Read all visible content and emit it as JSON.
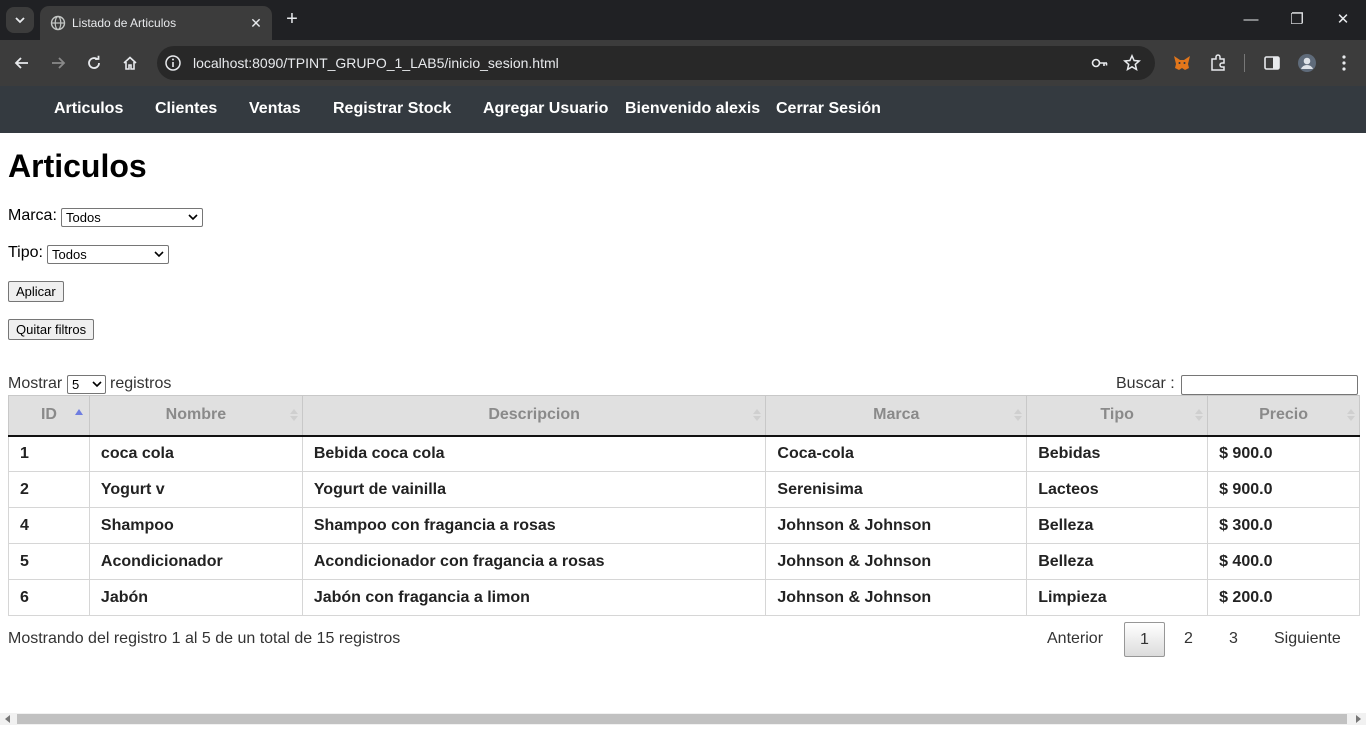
{
  "browser": {
    "tab_title": "Listado de Articulos",
    "tab_close": "✕",
    "new_tab": "+",
    "url": "localhost:8090/TPINT_GRUPO_1_LAB5/inicio_sesion.html",
    "window_controls": {
      "minimize": "—",
      "maximize": "❐",
      "close": "✕"
    }
  },
  "nav": {
    "items": [
      "Articulos",
      "Clientes",
      "Ventas",
      "Registrar Stock",
      "Agregar Usuario",
      "Bienvenido alexis",
      "Cerrar Sesión"
    ]
  },
  "page": {
    "title": "Articulos",
    "marca_label": "Marca:",
    "marca_value": "Todos",
    "tipo_label": "Tipo:",
    "tipo_value": "Todos",
    "apply_button": "Aplicar",
    "clear_button": "Quitar filtros"
  },
  "table_controls": {
    "show_label": "Mostrar",
    "page_length": "5",
    "records_label": "registros",
    "search_label": "Buscar :",
    "search_value": ""
  },
  "table": {
    "columns": [
      "ID",
      "Nombre",
      "Descripcion",
      "Marca",
      "Tipo",
      "Precio"
    ],
    "rows": [
      [
        "1",
        "coca cola",
        "Bebida coca cola",
        "Coca-cola",
        "Bebidas",
        "$ 900.0"
      ],
      [
        "2",
        "Yogurt v",
        "Yogurt de vainilla",
        "Serenisima",
        "Lacteos",
        "$ 900.0"
      ],
      [
        "4",
        "Shampoo",
        "Shampoo con fragancia a rosas",
        "Johnson & Johnson",
        "Belleza",
        "$ 300.0"
      ],
      [
        "5",
        "Acondicionador",
        "Acondicionador con fragancia a rosas",
        "Johnson & Johnson",
        "Belleza",
        "$ 400.0"
      ],
      [
        "6",
        "Jabón",
        "Jabón con fragancia a limon",
        "Johnson & Johnson",
        "Limpieza",
        "$ 200.0"
      ]
    ]
  },
  "footer": {
    "info": "Mostrando del registro 1 al 5 de un total de 15 registros",
    "previous": "Anterior",
    "pages": [
      "1",
      "2",
      "3"
    ],
    "next": "Siguiente"
  },
  "colors": {
    "nav_bg": "#343a40",
    "header_bg": "#e0e0e0",
    "sort_active": "#6f7ee0"
  }
}
